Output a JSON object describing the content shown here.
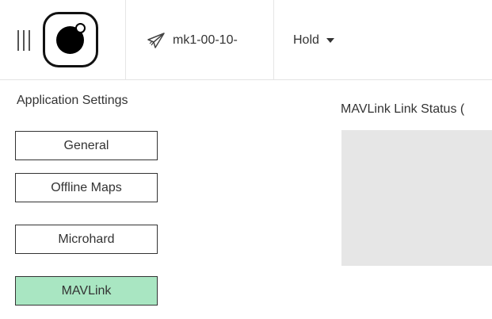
{
  "toolbar": {
    "menu_icon": "hamburger-menu-icon",
    "logo_icon": "app-logo-icon",
    "vehicle": {
      "icon": "paper-plane-icon",
      "label": "mk1-00-10-"
    },
    "flight_mode": {
      "label": "Hold",
      "dropdown_icon": "caret-down-icon"
    }
  },
  "sidebar": {
    "title": "Application Settings",
    "items": [
      {
        "label": "General",
        "active": false
      },
      {
        "label": "Offline Maps",
        "active": false
      },
      {
        "label": "Microhard",
        "active": false
      },
      {
        "label": "MAVLink",
        "active": true
      }
    ]
  },
  "main": {
    "section_title": "MAVLink Link Status ("
  },
  "colors": {
    "active_item_bg": "#a9e6c2",
    "panel_bg": "#e6e6e6",
    "border": "#333333"
  }
}
